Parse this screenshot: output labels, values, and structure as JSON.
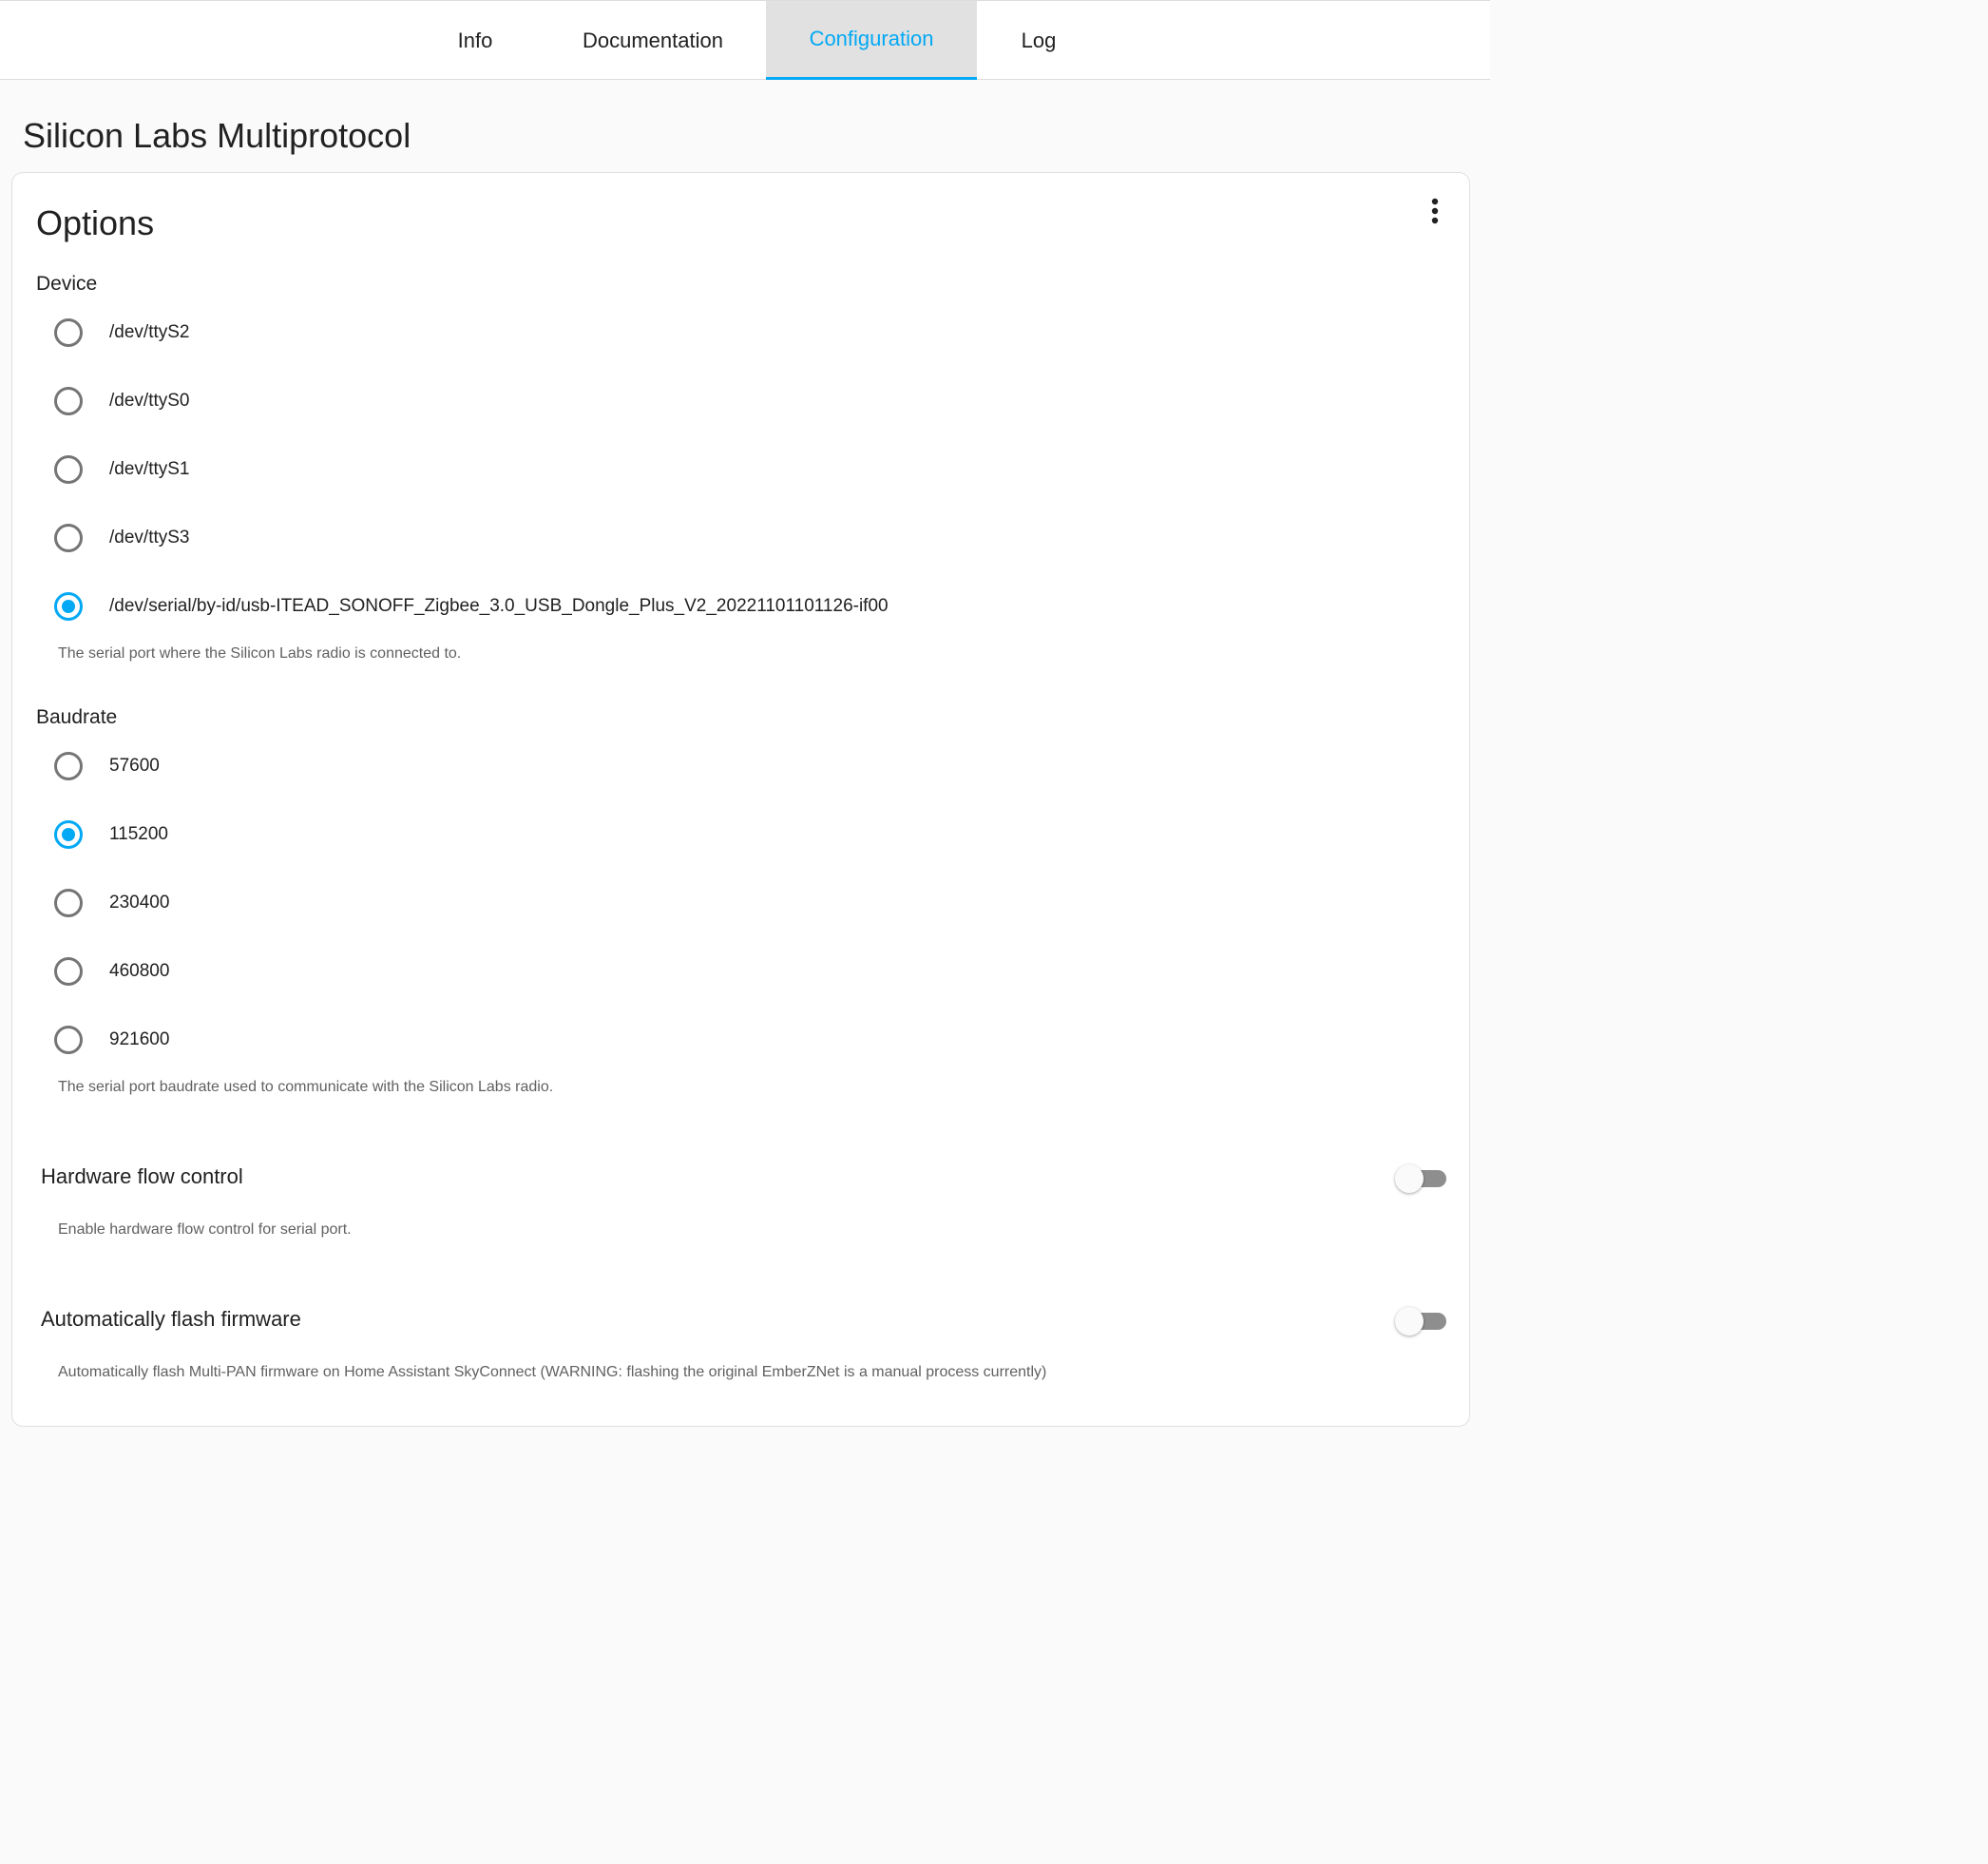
{
  "tabs": [
    {
      "label": "Info",
      "active": false
    },
    {
      "label": "Documentation",
      "active": false
    },
    {
      "label": "Configuration",
      "active": true
    },
    {
      "label": "Log",
      "active": false
    }
  ],
  "page_title": "Silicon Labs Multiprotocol",
  "card": {
    "title": "Options",
    "menu_icon": "more-vertical-icon"
  },
  "device": {
    "label": "Device",
    "options": [
      {
        "label": "/dev/ttyS2",
        "checked": false
      },
      {
        "label": "/dev/ttyS0",
        "checked": false
      },
      {
        "label": "/dev/ttyS1",
        "checked": false
      },
      {
        "label": "/dev/ttyS3",
        "checked": false
      },
      {
        "label": "/dev/serial/by-id/usb-ITEAD_SONOFF_Zigbee_3.0_USB_Dongle_Plus_V2_20221101101126-if00",
        "checked": true
      }
    ],
    "helper": "The serial port where the Silicon Labs radio is connected to."
  },
  "baudrate": {
    "label": "Baudrate",
    "options": [
      {
        "label": "57600",
        "checked": false
      },
      {
        "label": "115200",
        "checked": true
      },
      {
        "label": "230400",
        "checked": false
      },
      {
        "label": "460800",
        "checked": false
      },
      {
        "label": "921600",
        "checked": false
      }
    ],
    "helper": "The serial port baudrate used to communicate with the Silicon Labs radio."
  },
  "hardware_flow_control": {
    "label": "Hardware flow control",
    "enabled": false,
    "helper": "Enable hardware flow control for serial port."
  },
  "auto_flash": {
    "label": "Automatically flash firmware",
    "enabled": false,
    "helper": "Automatically flash Multi-PAN firmware on Home Assistant SkyConnect (WARNING: flashing the original EmberZNet is a manual process currently)"
  },
  "colors": {
    "accent": "#03a9f4",
    "active_tab_bg": "#e1e1e1",
    "switch_off_track": "#8e8e8e"
  }
}
